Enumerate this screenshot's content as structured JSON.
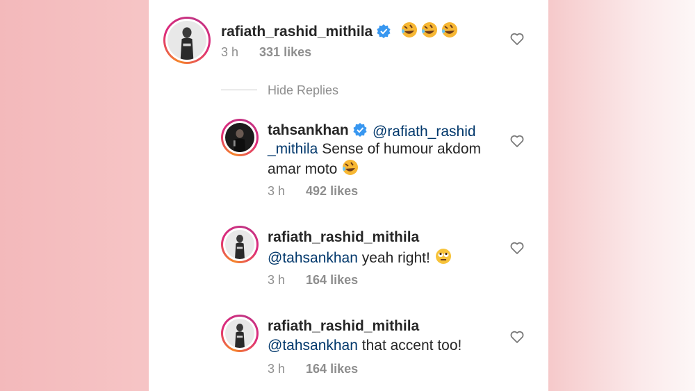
{
  "comments": [
    {
      "username": "rafiath_rashid_mithila",
      "verified": true,
      "emoji_text": "🤣🤣🤣",
      "mention": "",
      "text": "",
      "time": "3 h",
      "likes": "331 likes"
    }
  ],
  "hide_replies": "Hide Replies",
  "replies": [
    {
      "username": "tahsankhan",
      "verified": true,
      "mention": "@rafiath_rashid_mithila",
      "text_line1_mention_part": "@rafiath_rashid",
      "text_line2_mention_part": "_mithila",
      "text_line2_rest": " Sense of humour akdom",
      "text_line3": "amar moto",
      "time": "3 h",
      "likes": "492 likes"
    },
    {
      "username": "rafiath_rashid_mithila",
      "verified": false,
      "mention": "@tahsankhan",
      "text": " yeah right!",
      "time": "3 h",
      "likes": "164 likes"
    },
    {
      "username": "rafiath_rashid_mithila",
      "verified": false,
      "mention": "@tahsankhan",
      "text": " that accent too!",
      "time": "3 h",
      "likes": "164 likes"
    }
  ],
  "icons": {
    "verified": "verified-badge-icon",
    "heart": "heart-outline-icon",
    "laugh": "rolling-on-floor-laughing-emoji",
    "eyeroll": "eye-roll-emoji"
  },
  "colors": {
    "mention": "#00376b",
    "verified": "#3897f0",
    "meta": "#8e8e8e"
  }
}
